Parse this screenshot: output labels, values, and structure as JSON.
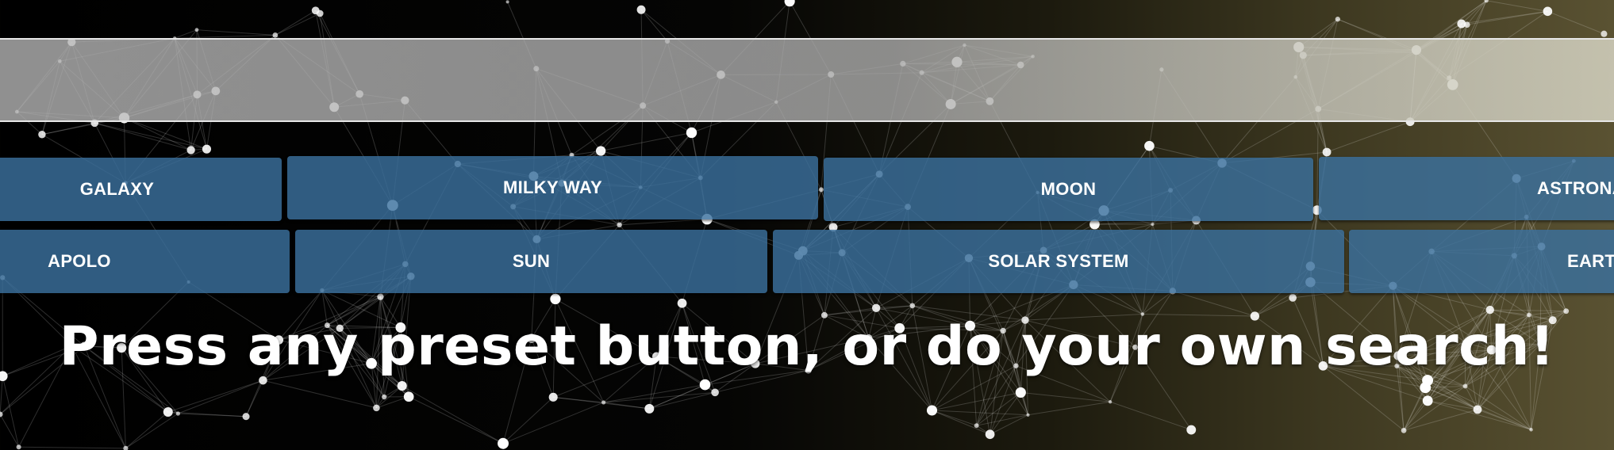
{
  "search": {
    "value": "",
    "placeholder": ""
  },
  "presets": [
    {
      "label": "GALAXY"
    },
    {
      "label": "MILKY WAY"
    },
    {
      "label": "MOON"
    },
    {
      "label": "ASTRONA"
    },
    {
      "label": "APOLO"
    },
    {
      "label": "SUN"
    },
    {
      "label": "SOLAR SYSTEM"
    },
    {
      "label": "EART"
    }
  ],
  "headline": "Press any preset button, or do your own search!",
  "colors": {
    "button": "#3a709e",
    "accent": "#5a5232"
  }
}
